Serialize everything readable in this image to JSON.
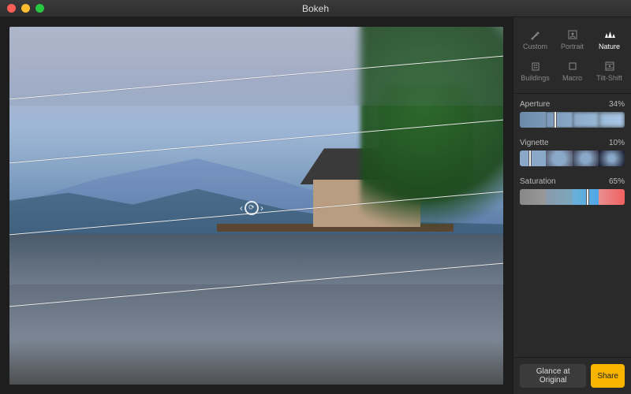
{
  "window": {
    "title": "Bokeh"
  },
  "presets": {
    "row1": [
      {
        "id": "custom",
        "label": "Custom",
        "icon": "brush"
      },
      {
        "id": "portrait",
        "label": "Portrait",
        "icon": "person"
      },
      {
        "id": "nature",
        "label": "Nature",
        "icon": "trees",
        "active": true
      }
    ],
    "row2": [
      {
        "id": "buildings",
        "label": "Buildings",
        "icon": "building"
      },
      {
        "id": "macro",
        "label": "Macro",
        "icon": "square"
      },
      {
        "id": "tiltshift",
        "label": "Tilt-Shift",
        "icon": "tilt"
      }
    ]
  },
  "sliders": {
    "aperture": {
      "label": "Aperture",
      "value": 34,
      "display": "34%"
    },
    "vignette": {
      "label": "Vignette",
      "value": 10,
      "display": "10%"
    },
    "saturation": {
      "label": "Saturation",
      "value": 65,
      "display": "65%"
    }
  },
  "footer": {
    "glance": "Glance at Original",
    "share": "Share"
  }
}
